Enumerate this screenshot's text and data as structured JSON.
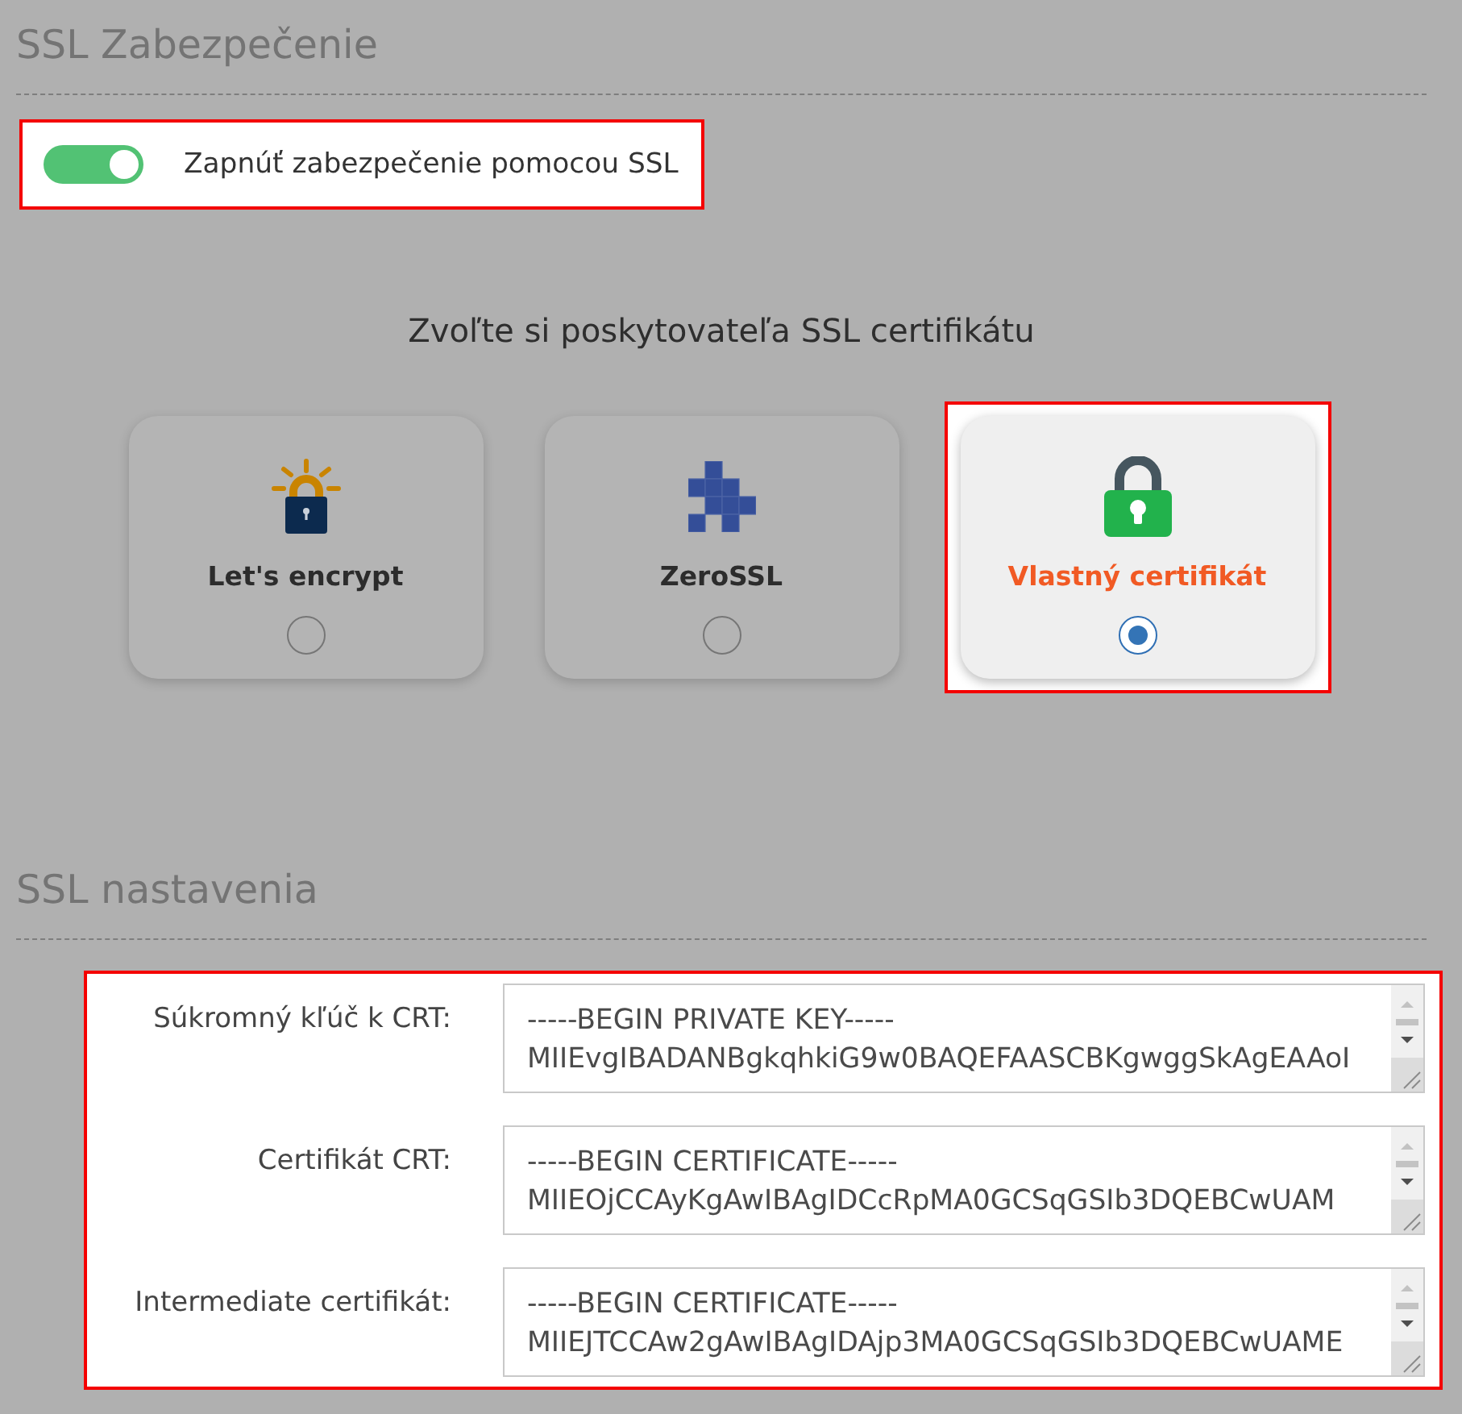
{
  "security": {
    "title": "SSL Zabezpečenie",
    "toggle": {
      "label": "Zapnúť zabezpečenie pomocou SSL",
      "on": true,
      "highlighted": true
    }
  },
  "provider": {
    "heading": "Zvoľte si poskytovateľa SSL certifikátu",
    "options": [
      {
        "kind": "letsencrypt",
        "label": "Let's encrypt",
        "selected": false,
        "highlighted": false
      },
      {
        "kind": "zerossl",
        "label": "ZeroSSL",
        "selected": false,
        "highlighted": false
      },
      {
        "kind": "custom",
        "label": "Vlastný certifikát",
        "selected": true,
        "highlighted": true
      }
    ]
  },
  "settings": {
    "title": "SSL nastavenia",
    "highlighted": true,
    "fields": [
      {
        "label": "Súkromný kľúč k CRT:",
        "value": "-----BEGIN PRIVATE KEY-----\nMIIEvgIBADANBgkqhkiG9w0BAQEFAASCBKgwggSkAgEAAoI"
      },
      {
        "label": "Certifikát CRT:",
        "value": "-----BEGIN CERTIFICATE-----\nMIIEOjCCAyKgAwIBAgIDCcRpMA0GCSqGSIb3DQEBCwUAM"
      },
      {
        "label": "Intermediate certifikát:",
        "value": "-----BEGIN CERTIFICATE-----\nMIIEJTCCAw2gAwIBAgIDAjp3MA0GCSqGSIb3DQEBCwUAME"
      }
    ]
  }
}
